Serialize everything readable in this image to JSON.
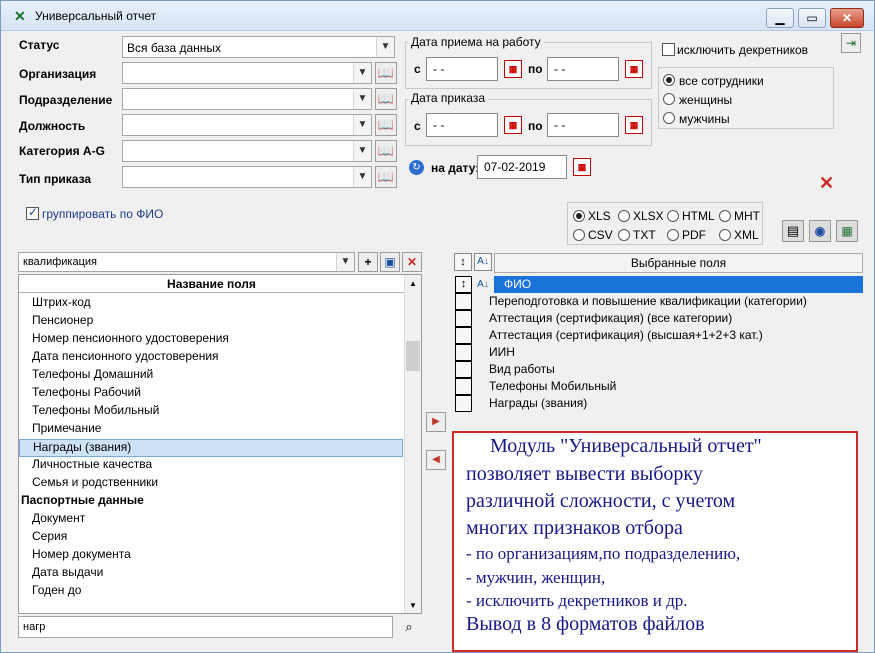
{
  "window": {
    "title": "Универсальный отчет",
    "controls": {
      "minimize": "▁",
      "maximize": "▭",
      "close": "✕"
    }
  },
  "filters": {
    "status_label": "Статус",
    "status_value": "Вся база данных",
    "org_label": "Организация",
    "dept_label": "Подразделение",
    "position_label": "Должность",
    "category_label": "Категория A-G",
    "order_type_label": "Тип приказа",
    "group_by_fio": "группировать по ФИО"
  },
  "hire_date": {
    "title": "Дата приема на работу",
    "from_label": "с",
    "to_label": "по",
    "from_value": "- -",
    "to_value": "- -"
  },
  "order_date": {
    "title": "Дата приказа",
    "from_label": "с",
    "to_label": "по",
    "from_value": "- -",
    "to_value": "- -"
  },
  "on_date": {
    "label": "на дату:",
    "value": "07-02-2019"
  },
  "exclude_maternity": "исключить декретников",
  "gender": {
    "options": [
      "все сотрудники",
      "женщины",
      "мужчины"
    ],
    "selected": 0
  },
  "formats": {
    "options": [
      "XLS",
      "XLSX",
      "HTML",
      "MHT",
      "CSV",
      "TXT",
      "PDF",
      "XML"
    ],
    "selected": 0
  },
  "left_list": {
    "filter_value": "квалификация",
    "header": "Название поля",
    "items": [
      "Штрих-код",
      "Пенсионер",
      "Номер пенсионного удостоверения",
      "Дата пенсионного удостоверения",
      "Телефоны Домашний",
      "Телефоны Рабочий",
      "Телефоны Мобильный",
      "Примечание",
      "Награды (звания)",
      "Личностные качества",
      "Семья и родственники"
    ],
    "selected_index": 8,
    "group_header": "Паспортные данные",
    "group_items": [
      "Документ",
      "Серия",
      "Номер документа",
      "Дата выдачи",
      "Годен до"
    ],
    "search_value": "нагр"
  },
  "right_list": {
    "header": "Выбранные поля",
    "items": [
      "ФИО",
      "Переподготовка и повышение квалификации (категории)",
      "Аттестация (сертификация) (все категории)",
      "Аттестация (сертификация) (высшая+1+2+3 кат.)",
      "ИИН",
      "Вид работы",
      "Телефоны Мобильный",
      "Награды (звания)"
    ]
  },
  "info": {
    "line1": "Модуль \"Универсальный отчет\"",
    "line2": "позволяет вывести выборку",
    "line3": "различной сложности, с учетом",
    "line4": "многих признаков отбора",
    "line5": "- по организациям,по подразделению,",
    "line6": "- мужчин, женщин,",
    "line7": "- исключить декретников и др.",
    "line8": "Вывод в 8 форматов файлов"
  },
  "colors": {
    "accent": "#1a73d9",
    "info_border": "#d12828",
    "info_text": "#16188a",
    "selected_row": "#1a73d9"
  }
}
